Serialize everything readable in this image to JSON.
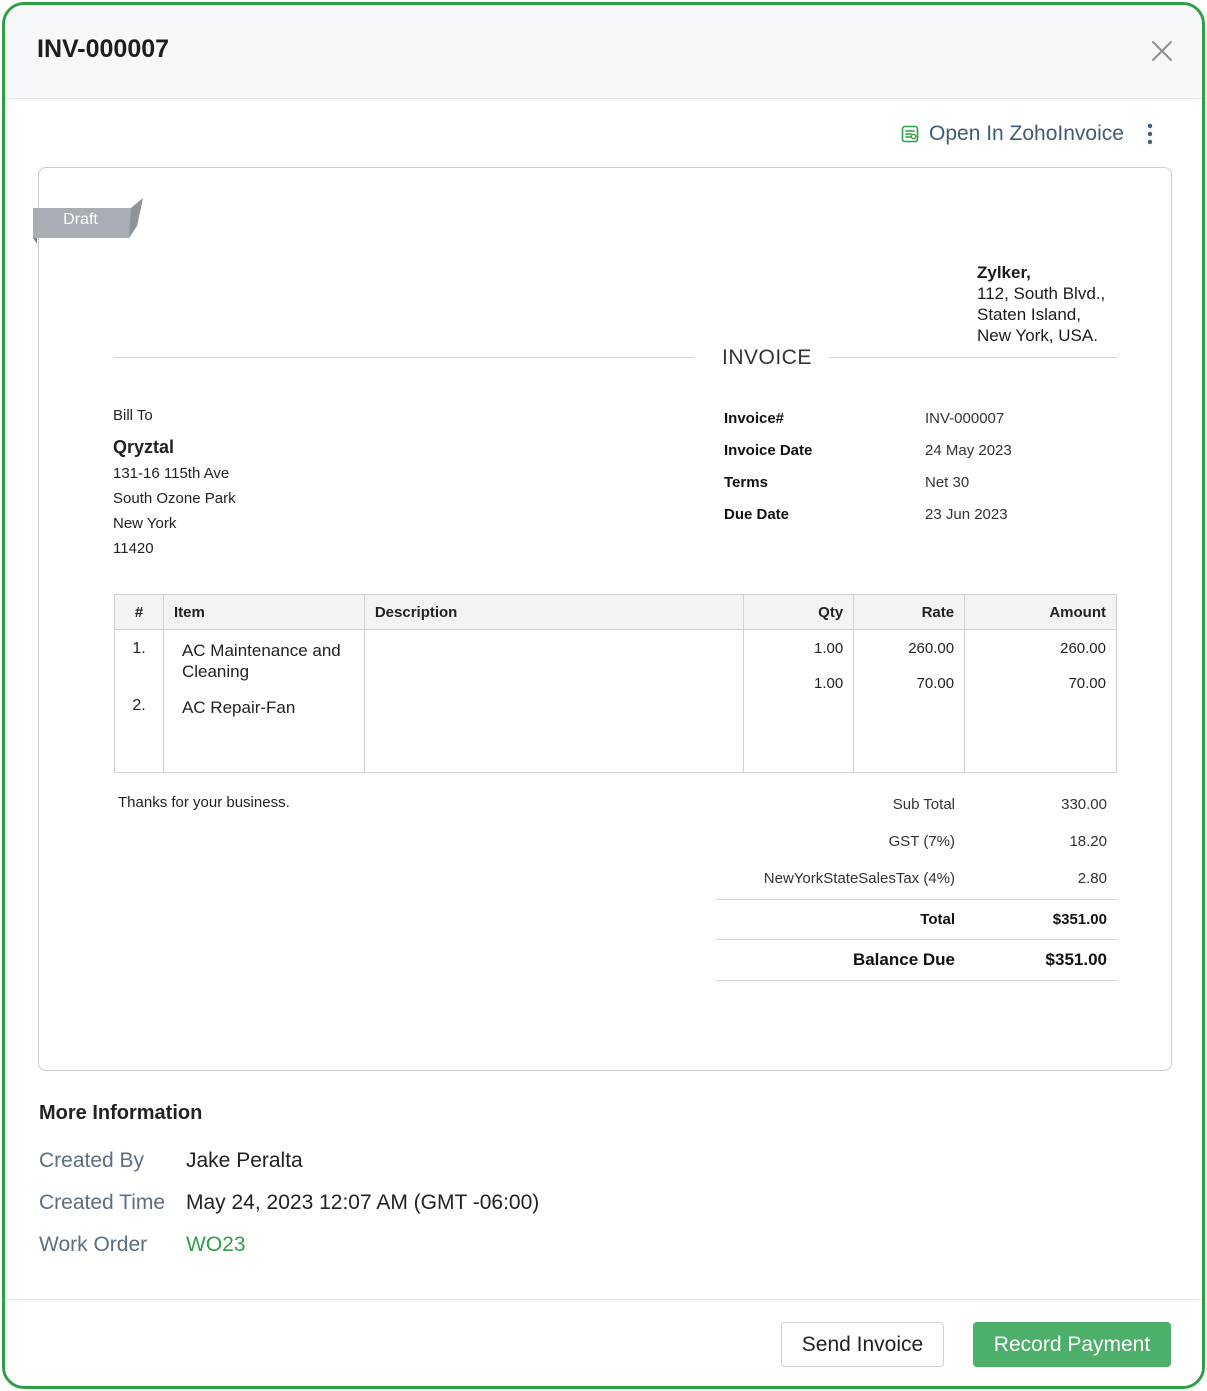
{
  "modal": {
    "title": "INV-000007"
  },
  "toolbar": {
    "open_link_label": "Open In ZohoInvoice",
    "open_icon": "zoho-invoice-icon",
    "more_icon": "more-vertical-icon",
    "close_icon": "close-icon"
  },
  "invoice": {
    "status_ribbon": "Draft",
    "org": {
      "name": "Zylker,",
      "address": [
        "112, South Blvd.,",
        "Staten Island,",
        "New York, USA."
      ]
    },
    "doc_title": "INVOICE",
    "bill_to": {
      "label": "Bill To",
      "name": "Qryztal",
      "address": [
        "131-16 115th Ave",
        "South Ozone Park",
        "New York",
        "11420"
      ]
    },
    "meta": [
      {
        "label": "Invoice#",
        "value": "INV-000007"
      },
      {
        "label": "Invoice Date",
        "value": "24 May 2023"
      },
      {
        "label": "Terms",
        "value": "Net 30"
      },
      {
        "label": "Due Date",
        "value": "23 Jun 2023"
      }
    ],
    "columns": {
      "num": "#",
      "item": "Item",
      "description": "Description",
      "qty": "Qty",
      "rate": "Rate",
      "amount": "Amount"
    },
    "items": [
      {
        "num": "1.",
        "item": "AC Maintenance and Cleaning",
        "description": "",
        "qty": "1.00",
        "rate": "260.00",
        "amount": "260.00"
      },
      {
        "num": "2.",
        "item": "AC Repair-Fan",
        "description": "",
        "qty": "1.00",
        "rate": "70.00",
        "amount": "70.00"
      }
    ],
    "notes": "Thanks for your business.",
    "totals": {
      "subtotal_label": "Sub Total",
      "subtotal": "330.00",
      "gst_label": "GST (7%)",
      "gst": "18.20",
      "nytax_label": "NewYorkStateSalesTax (4%)",
      "nytax": "2.80",
      "total_label": "Total",
      "total": "$351.00",
      "balance_label": "Balance Due",
      "balance": "$351.00"
    }
  },
  "more_info": {
    "title": "More Information",
    "created_by_label": "Created By",
    "created_by": "Jake Peralta",
    "created_time_label": "Created Time",
    "created_time": "May 24, 2023 12:07 AM (GMT -06:00)",
    "work_order_label": "Work Order",
    "work_order": "WO23"
  },
  "footer": {
    "send_label": "Send Invoice",
    "record_label": "Record Payment"
  },
  "colors": {
    "accent_green": "#2f9e44",
    "primary_button": "#4caf6a",
    "ribbon_gray": "#a9adb4",
    "label_slate": "#5b6e82"
  }
}
